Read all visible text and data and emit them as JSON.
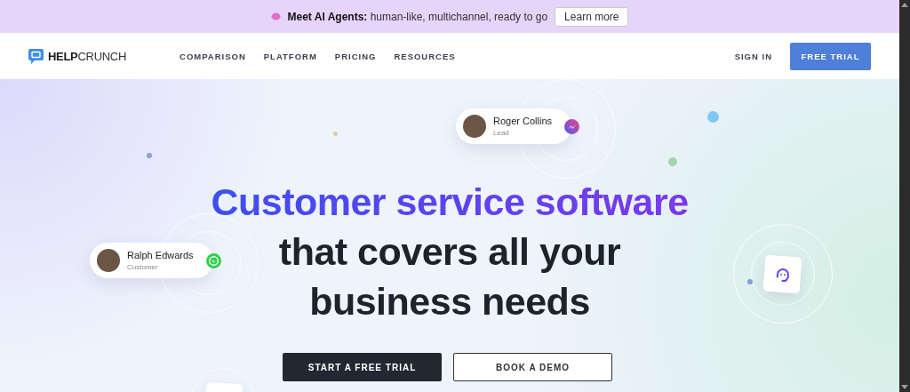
{
  "announcement": {
    "title": "Meet AI Agents:",
    "text": "human-like, multichannel, ready to go",
    "button": "Learn more"
  },
  "nav": {
    "logo_bold": "HELP",
    "logo_light": "CRUNCH",
    "links": [
      "COMPARISON",
      "PLATFORM",
      "PRICING",
      "RESOURCES"
    ],
    "sign_in": "SIGN IN",
    "cta": "FREE TRIAL"
  },
  "hero": {
    "headline": [
      {
        "text": "Customer service software",
        "kind": "gradient"
      },
      {
        "text": "that covers all your",
        "kind": "plain"
      },
      {
        "text": "business needs",
        "kind": "plain"
      }
    ],
    "contacts": [
      {
        "name": "Roger Collins",
        "role": "Lead",
        "kind": "messenger"
      },
      {
        "name": "Ralph Edwards",
        "role": "Customer",
        "kind": "whatsapp"
      }
    ],
    "primary_button": "START A FREE TRIAL",
    "secondary_button": "BOOK A DEMO"
  }
}
